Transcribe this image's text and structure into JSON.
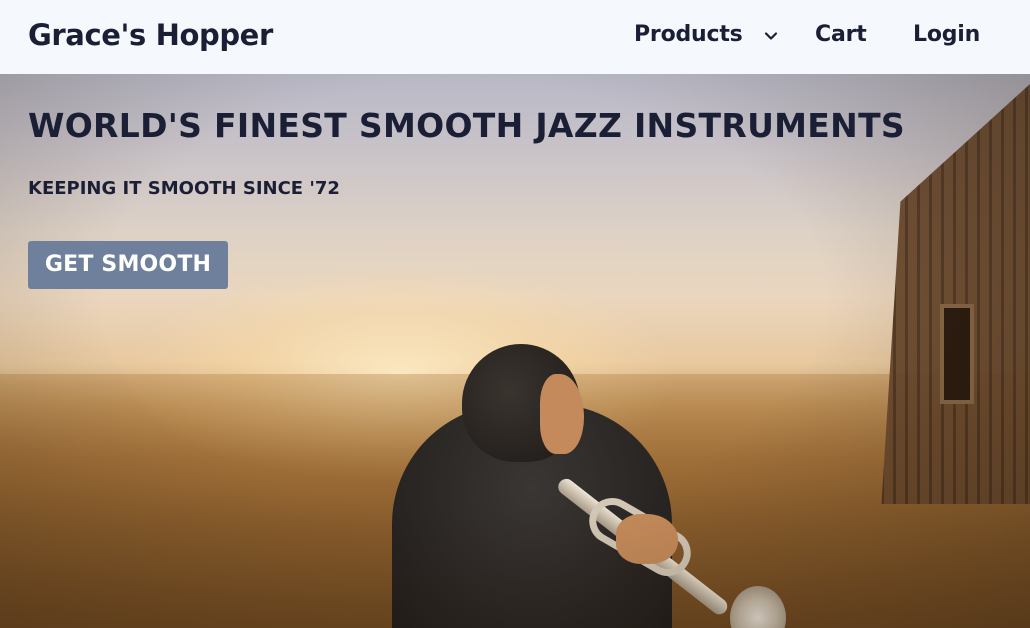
{
  "navbar": {
    "brand": "Grace's Hopper",
    "products_label": "Products",
    "products_icon": "chevron-down-icon",
    "cart_label": "Cart",
    "login_label": "Login"
  },
  "hero": {
    "title": "WORLD'S FINEST SMOOTH JAZZ INSTRUMENTS",
    "subtitle": "KEEPING IT SMOOTH SINCE '72",
    "cta_label": "GET SMOOTH"
  },
  "colors": {
    "navbar_bg": "#f5f8fc",
    "text": "#1b1f36",
    "cta_bg": "#6f809c",
    "cta_text": "#ffffff"
  }
}
